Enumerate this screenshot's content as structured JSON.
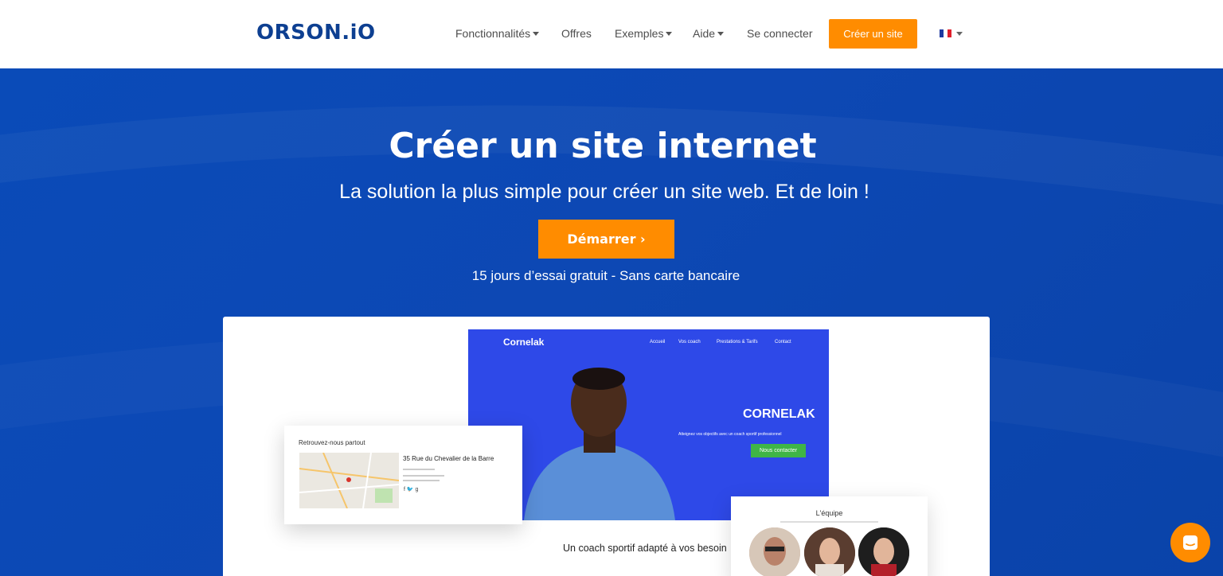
{
  "header": {
    "logo": "ORSON.iO",
    "nav": {
      "features": "Fonctionnalités",
      "offers": "Offres",
      "examples": "Exemples",
      "help": "Aide",
      "login": "Se connecter"
    },
    "cta": "Créer un site",
    "language_icon": "fr-flag-icon"
  },
  "hero": {
    "title": "Créer un site internet",
    "subtitle": "La solution la plus simple pour créer un site web. Et de loin !",
    "button": "Démarrer ›",
    "note": "15 jours d’essai gratuit - Sans carte bancaire"
  },
  "showcase": {
    "site": {
      "logo": "Cornelak",
      "nav": [
        "Accueil",
        "Vos coach",
        "Prestations & Tarifs",
        "Contact"
      ],
      "brand": "CORNELAK",
      "tagline": "Atteignez vos objectifs avec un coach sportif professionnel",
      "cta": "Nous contacter"
    },
    "map_card": {
      "title": "Retrouvez-nous partout",
      "address": "35 Rue du Chevalier de la Barre"
    },
    "team_card": {
      "title": "L'équipe"
    },
    "caption": "Un coach sportif adapté à vos besoin"
  },
  "chat_icon": "chat-bubble-icon",
  "colors": {
    "brand_blue": "#0d3f91",
    "hero_blue": "#0b47b4",
    "accent_orange": "#ff8c00",
    "mock_blue": "#2e49e8",
    "mock_green": "#3fb546"
  }
}
